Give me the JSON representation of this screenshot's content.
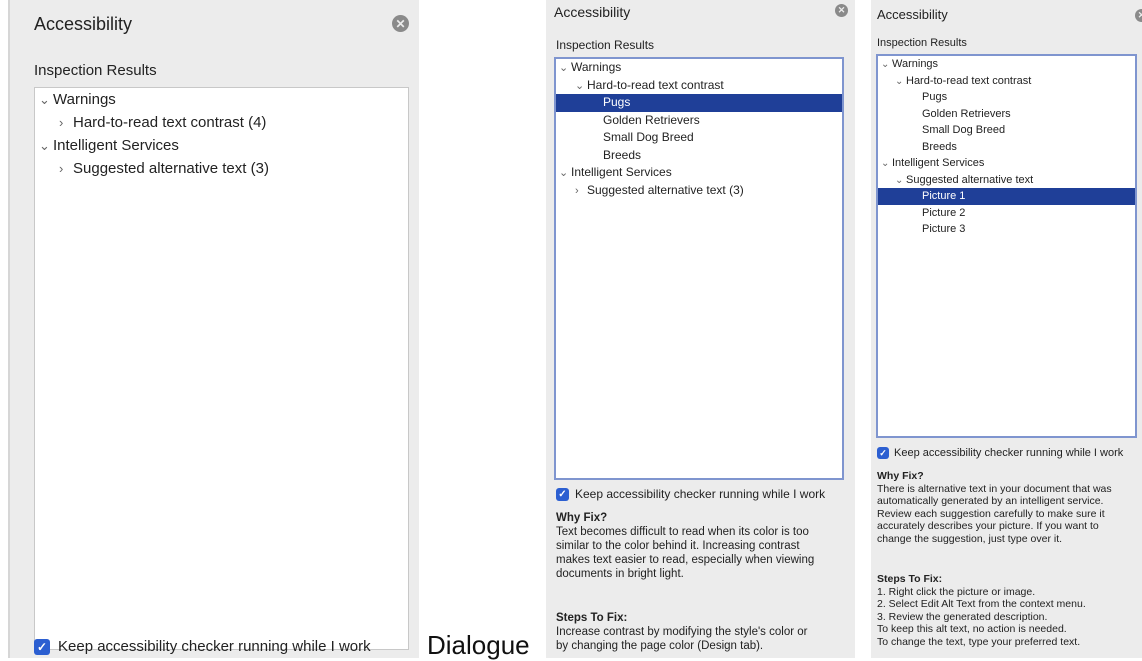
{
  "caption": "Dialogue",
  "panel1": {
    "title": "Accessibility",
    "subtitle": "Inspection Results",
    "tree": [
      {
        "label": "Warnings",
        "caret": "v"
      },
      {
        "label": "Hard-to-read text contrast (4)",
        "caret": ">"
      },
      {
        "label": "Intelligent Services",
        "caret": "v"
      },
      {
        "label": "Suggested alternative text (3)",
        "caret": ">"
      }
    ],
    "keep_label": "Keep accessibility checker running while I work"
  },
  "panel2": {
    "title": "Accessibility",
    "subtitle": "Inspection Results",
    "tree": [
      {
        "label": "Warnings",
        "caret": "v"
      },
      {
        "label": "Hard-to-read text contrast",
        "caret": "v"
      },
      {
        "label": "Pugs"
      },
      {
        "label": "Golden Retrievers"
      },
      {
        "label": "Small Dog Breed"
      },
      {
        "label": "Breeds"
      },
      {
        "label": "Intelligent Services",
        "caret": "v"
      },
      {
        "label": "Suggested alternative text (3)",
        "caret": ">"
      }
    ],
    "selected": "Pugs",
    "keep_label": "Keep accessibility checker running while I work",
    "why_fix": {
      "heading": "Why Fix?",
      "lines": [
        "Text becomes difficult to read when its color is too",
        "similar to the color behind it. Increasing contrast",
        "makes text easier to read, especially when viewing",
        "documents in bright light."
      ]
    },
    "steps": {
      "heading": "Steps To Fix:",
      "lines": [
        "Increase contrast by modifying the style's color or",
        "by changing the page color (Design tab)."
      ]
    }
  },
  "panel3": {
    "title": "Accessibility",
    "subtitle": "Inspection Results",
    "tree": [
      {
        "label": "Warnings",
        "caret": "v"
      },
      {
        "label": "Hard-to-read text contrast",
        "caret": "v"
      },
      {
        "label": "Pugs"
      },
      {
        "label": "Golden Retrievers"
      },
      {
        "label": "Small Dog Breed"
      },
      {
        "label": "Breeds"
      },
      {
        "label": "Intelligent Services",
        "caret": "v"
      },
      {
        "label": "Suggested alternative text",
        "caret": "v"
      },
      {
        "label": "Picture 1"
      },
      {
        "label": "Picture 2"
      },
      {
        "label": "Picture 3"
      }
    ],
    "selected": "Picture 1",
    "keep_label": "Keep accessibility checker running while I work",
    "why_fix": {
      "heading": "Why Fix?",
      "lines": [
        "There is alternative text in your document that was",
        "automatically generated by an intelligent service.",
        "Review each suggestion carefully to make sure it",
        "accurately describes your picture. If you want to",
        "change the suggestion, just type over it."
      ]
    },
    "steps": {
      "heading": "Steps To Fix:",
      "lines": [
        "1. Right click the picture or image.",
        "2. Select Edit Alt Text from the context menu.",
        "3. Review the generated description.",
        "To keep this alt text, no action is needed.",
        "To change the text, type your preferred text."
      ]
    }
  },
  "icons": {
    "close": "close-circle-icon",
    "expanded": "chevron-down-icon",
    "collapsed": "chevron-right-icon",
    "checkbox": "checkmark-icon"
  },
  "colors": {
    "panel_bg": "#ececec",
    "selection": "#1f3f98",
    "focus_border": "#7f95cf",
    "checkbox": "#2c5fd1"
  }
}
